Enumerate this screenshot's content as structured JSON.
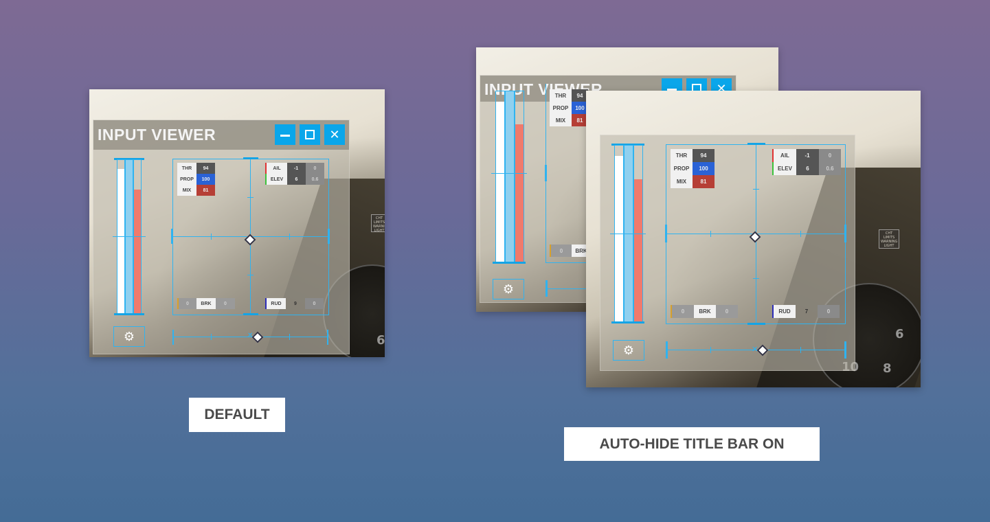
{
  "default": {
    "caption": "DEFAULT",
    "widget": {
      "title": "INPUT VIEWER",
      "buttons": {
        "minimize_icon": "minimize-icon",
        "popout_icon": "popout-icon",
        "close_icon": "close-icon"
      },
      "engine": [
        {
          "label": "THR",
          "value": "94"
        },
        {
          "label": "PROP",
          "value": "100"
        },
        {
          "label": "MIX",
          "value": "81"
        }
      ],
      "flight": [
        {
          "label": "AIL",
          "value": "-1",
          "trim": "0"
        },
        {
          "label": "ELEV",
          "value": "6",
          "trim": "0.6"
        }
      ],
      "brake": {
        "left": "0",
        "label": "BRK",
        "right": "0"
      },
      "rudder": {
        "label": "RUD",
        "value": "9",
        "trim": "0"
      },
      "settings_icon": "gear-icon"
    }
  },
  "autohide": {
    "caption": "AUTO-HIDE TITLE BAR ON",
    "widget_back": {
      "title": "INPUT VIEWER",
      "engine": [
        {
          "label": "THR",
          "value": "94"
        },
        {
          "label": "PROP",
          "value": "100"
        },
        {
          "label": "MIX",
          "value": "81"
        }
      ],
      "brake": {
        "left": "0",
        "label": "BRK"
      }
    },
    "widget_front": {
      "engine": [
        {
          "label": "THR",
          "value": "94"
        },
        {
          "label": "PROP",
          "value": "100"
        },
        {
          "label": "MIX",
          "value": "81"
        }
      ],
      "flight": [
        {
          "label": "AIL",
          "value": "-1",
          "trim": "0"
        },
        {
          "label": "ELEV",
          "value": "6",
          "trim": "0.6"
        }
      ],
      "brake": {
        "left": "0",
        "label": "BRK",
        "right": "0"
      },
      "rudder": {
        "label": "RUD",
        "value": "7",
        "trim": "0"
      },
      "settings_icon": "gear-icon"
    }
  },
  "colors": {
    "accent": "#0aa6ea",
    "throttle_bar": "#ffffff",
    "prop_bar": "#8fd0ef",
    "mix_bar": "#f07a6c",
    "prop_value_bg": "#2a62d6",
    "mix_value_bg": "#b63f36",
    "ail_marker": "#e03434",
    "elev_marker": "#3cc23c",
    "brk_marker": "#d8a12a",
    "rud_marker": "#2d2db8"
  },
  "levels": {
    "throttle": 0.94,
    "prop": 1.0,
    "mix": 0.81
  }
}
